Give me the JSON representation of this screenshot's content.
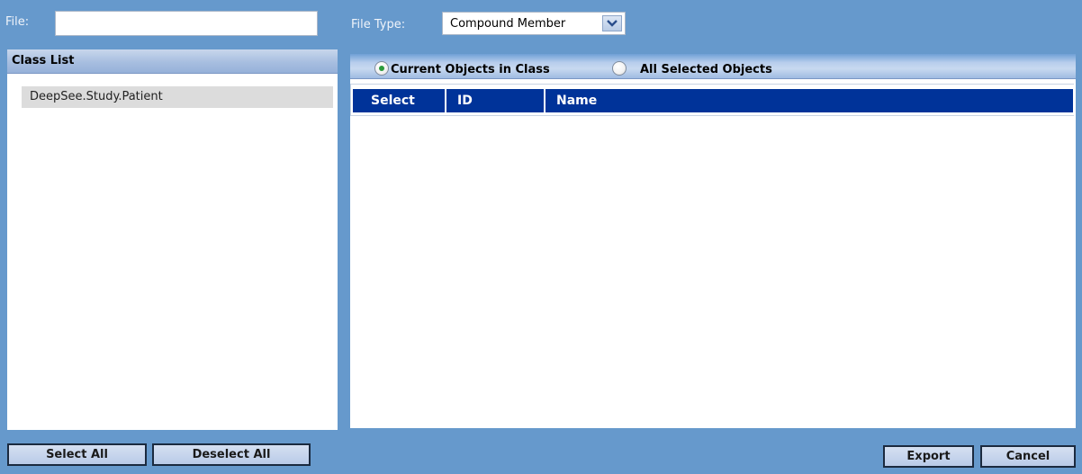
{
  "top_bar": {
    "file_label": "File:",
    "file_value": "",
    "file_type_label": "File Type:",
    "file_type_selected": "Compound Member"
  },
  "class_list": {
    "title": "Class List",
    "items": [
      "DeepSee.Study.Patient"
    ]
  },
  "objects_panel": {
    "radio_current": "Current Objects in Class",
    "radio_all": "All Selected Objects",
    "selected_radio": "current",
    "columns": [
      "Select",
      "ID",
      "Name"
    ],
    "rows": []
  },
  "buttons": {
    "select_all": "Select All",
    "deselect_all": "Deselect All",
    "export": "Export",
    "cancel": "Cancel"
  }
}
